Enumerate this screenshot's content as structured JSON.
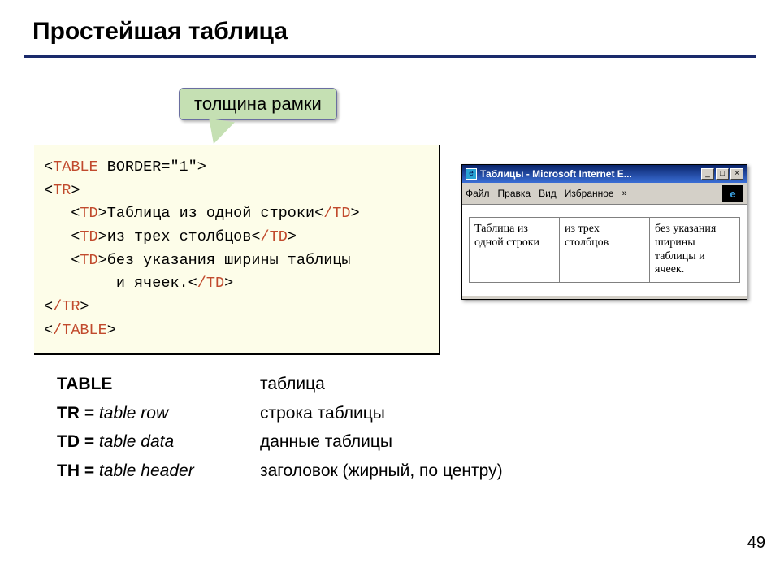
{
  "title": "Простейшая таблица",
  "callout": "толщина рамки",
  "code": {
    "t_open": "TABLE",
    "border_attr": " BORDER=\"1\"",
    "tr": "TR",
    "td": "TD",
    "td_close": "/TD",
    "tr_close": "/TR",
    "t_close": "/TABLE",
    "cell1": "Таблица из одной строки",
    "cell2": "из трех столбцов",
    "cell3a": "без указания ширины таблицы",
    "cell3b": "и ячеек."
  },
  "defs": [
    {
      "bold": "TABLE",
      "ital": "",
      "desc": "таблица"
    },
    {
      "bold": "TR =",
      "ital": " table row",
      "desc": "строка таблицы"
    },
    {
      "bold": "TD =",
      "ital": " table data",
      "desc": "данные таблицы"
    },
    {
      "bold": "TH =",
      "ital": " table header",
      "desc": "заголовок (жирный, по центру)"
    }
  ],
  "browser": {
    "title": "Таблицы - Microsoft Internet E...",
    "menu": {
      "file": "Файл",
      "edit": "Правка",
      "view": "Вид",
      "fav": "Избранное"
    },
    "cells": [
      "Таблица из одной строки",
      "из трех столбцов",
      "без указания ширины таблицы и ячеек."
    ]
  },
  "page": "49"
}
